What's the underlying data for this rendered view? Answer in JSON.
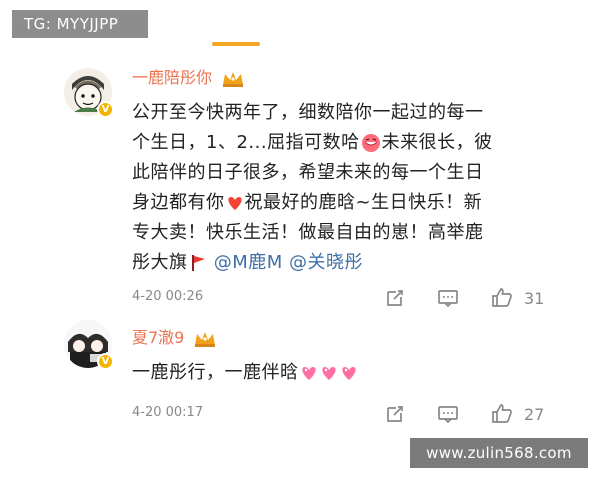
{
  "overlay": {
    "tg_label": "TG: MYYJJPP",
    "watermark": "www.zulin568.com"
  },
  "comments": [
    {
      "username": "一鹿陪彤你",
      "lines": [
        "公开至今快两年了，细数陪你一起过的每一",
        "个生日，1、2...屈指可数哈",
        "未来很长，彼",
        "此陪伴的日子很多，希望未来的每一个生日",
        "身边都有你",
        "祝最好的鹿晗~生日快乐！新",
        "专大卖！快乐生活！做最自由的崽！高举鹿",
        "彤大旗",
        "@M鹿M",
        "@关晓彤"
      ],
      "time": "4-20 00:26",
      "like_count": "31",
      "inline_icons": [
        "laughing-emoji",
        "red-heart-emoji",
        "red-flag-emoji"
      ]
    },
    {
      "username": "夏7澈9",
      "text": "一鹿彤行，一鹿伴晗",
      "time": "4-20 00:17",
      "like_count": "27",
      "inline_icons": [
        "pink-heart-emoji",
        "pink-heart-emoji",
        "pink-heart-emoji"
      ]
    }
  ],
  "colors": {
    "username": "#eb7350",
    "mention": "#3f6fa5",
    "accent": "#f5a623",
    "meta": "#888888"
  },
  "icons": [
    "crown-badge-icon",
    "verified-badge-icon",
    "repost-icon",
    "comment-icon",
    "like-icon"
  ]
}
